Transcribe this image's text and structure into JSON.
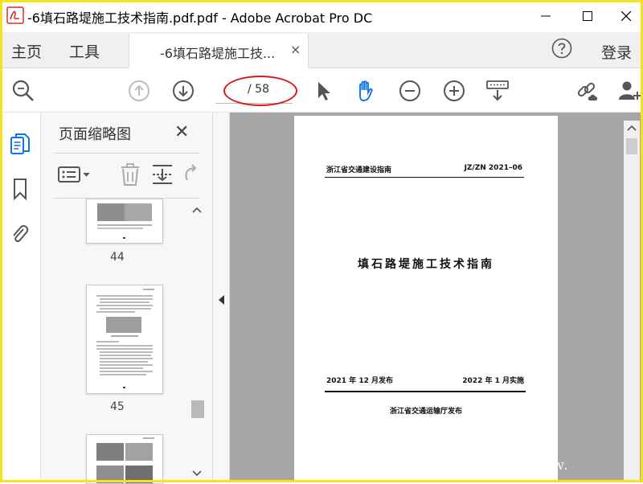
{
  "window": {
    "title": "-6填石路堤施工技术指南.pdf.pdf - Adobe Acrobat Pro DC"
  },
  "tabs": {
    "home": "主页",
    "tools": "工具",
    "document_tab": "-6填石路堤施工技...",
    "document_tab_close": "×",
    "login": "登录"
  },
  "toolbar": {
    "page_indicator": "/ 58",
    "icons": [
      "search-icon",
      "prev-page-icon",
      "next-page-icon",
      "select-cursor-icon",
      "hand-tool-icon",
      "zoom-out-icon",
      "zoom-in-icon",
      "keyboard-scroll-icon",
      "share-link-icon",
      "add-user-icon"
    ]
  },
  "thumbnail_panel": {
    "title": "页面缩略图",
    "close": "✕",
    "pages": [
      {
        "number": "44"
      },
      {
        "number": "45"
      },
      {
        "number": ""
      }
    ]
  },
  "document": {
    "header_left": "浙江省交通建设指南",
    "header_right": "JZ/ZN 2021–06",
    "title": "填石路堤施工技术指南",
    "date_left": "2021 年 12 月发布",
    "date_right": "2022 年 1 月实施",
    "publisher": "浙江省交通运输厅发布"
  },
  "watermark": "www.",
  "colors": {
    "highlight_oval": "#d61818",
    "frame": "#f4e21a",
    "accent_blue": "#1473e6"
  }
}
